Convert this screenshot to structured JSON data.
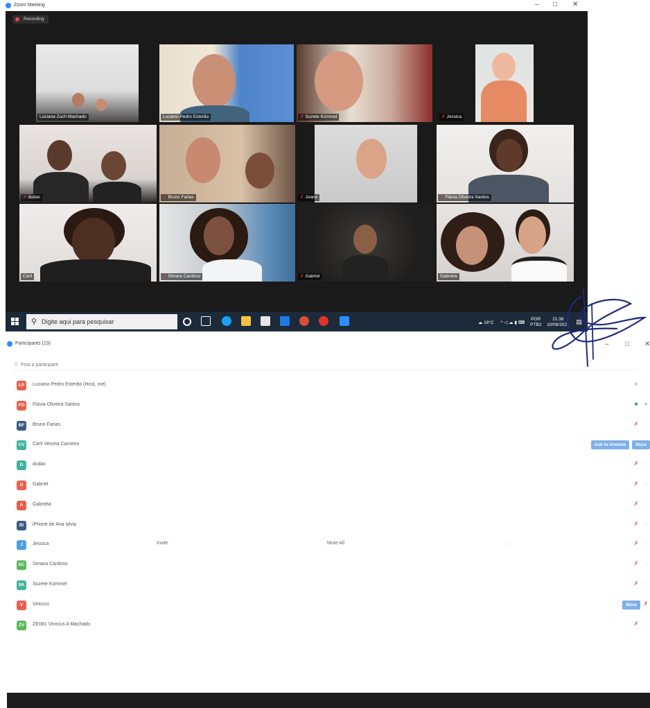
{
  "zoom_window": {
    "title": "Zoom Meeting",
    "window_controls": [
      "–",
      "□",
      "✕"
    ],
    "recording_label": "Recording",
    "tiles": [
      {
        "name": "Luciana Zuch Machado",
        "muted": false,
        "active": false
      },
      {
        "name": "Luciano Pedro Esterão",
        "muted": false,
        "active": false
      },
      {
        "name": "Suzete Kümmel",
        "muted": true,
        "active": false
      },
      {
        "name": "Jessica",
        "muted": true,
        "active": false
      },
      {
        "name": "dudac",
        "muted": true,
        "active": false
      },
      {
        "name": "Bruno Farias",
        "muted": true,
        "active": false
      },
      {
        "name": "Joane",
        "muted": true,
        "active": false
      },
      {
        "name": "Flávia Oliveira Santos",
        "muted": true,
        "active": false
      },
      {
        "name": "Carli",
        "muted": false,
        "active": true
      },
      {
        "name": "Simara Cardoso",
        "muted": true,
        "active": false
      },
      {
        "name": "Gabriel",
        "muted": true,
        "active": false
      },
      {
        "name": "Gabriela",
        "muted": false,
        "active": false
      }
    ]
  },
  "taskbar": {
    "search_placeholder": "Digite aqui para pesquisar",
    "weather": "18°C",
    "language": "POR",
    "layout": "PTB2",
    "time": "21:38",
    "date": "10/08/2021"
  },
  "participants_window": {
    "title": "Participants (13)",
    "window_controls": [
      "–",
      "□",
      "✕"
    ],
    "search_placeholder": "Find a participant",
    "participants": [
      {
        "initials": "LP",
        "name": "Luciano Pedro Esterão (Host, me)",
        "color": "#e8604c",
        "mic": "on",
        "video": "off",
        "buttons": []
      },
      {
        "initials": "FO",
        "name": "Flavia Oliveira Santos",
        "color": "#e8604c",
        "mic": "on",
        "video": "on",
        "buttons": []
      },
      {
        "initials": "BF",
        "name": "Bruno Farias",
        "color": "#3d5a80",
        "mic": "off",
        "video": "off",
        "buttons": []
      },
      {
        "initials": "CV",
        "name": "Carli Verona Carneiro",
        "color": "#3fb39b",
        "mic": "none",
        "video": "none",
        "buttons": [
          "Ask to Unmute",
          "More"
        ]
      },
      {
        "initials": "D",
        "name": "dudac",
        "color": "#3fb39b",
        "mic": "off",
        "video": "off",
        "buttons": []
      },
      {
        "initials": "G",
        "name": "Gabriel",
        "color": "#e8604c",
        "mic": "off",
        "video": "off",
        "buttons": []
      },
      {
        "initials": "A",
        "name": "Gabriela",
        "color": "#e8604c",
        "mic": "off",
        "video": "off",
        "buttons": []
      },
      {
        "initials": "ID",
        "name": "iPhone de Ana silvia",
        "color": "#3d5a80",
        "mic": "off",
        "video": "off",
        "buttons": []
      },
      {
        "initials": "J",
        "name": "Jessica",
        "color": "#4a9fe0",
        "mic": "off",
        "video": "off",
        "buttons": []
      },
      {
        "initials": "SC",
        "name": "Simara Cardoso",
        "color": "#5cb85c",
        "mic": "off",
        "video": "off",
        "buttons": []
      },
      {
        "initials": "SK",
        "name": "Suzete Kümmel",
        "color": "#3fb39b",
        "mic": "off",
        "video": "off",
        "buttons": []
      },
      {
        "initials": "V",
        "name": "Vinicius",
        "color": "#e8604c",
        "mic": "off",
        "video": "none",
        "buttons": [
          "More"
        ]
      },
      {
        "initials": "ZV",
        "name": "ZE081 Vinicius A Machado",
        "color": "#5cb85c",
        "mic": "off",
        "video": "off",
        "buttons": []
      }
    ],
    "footer": {
      "invite": "Invite",
      "mute_all": "Mute All",
      "more": "..."
    }
  }
}
